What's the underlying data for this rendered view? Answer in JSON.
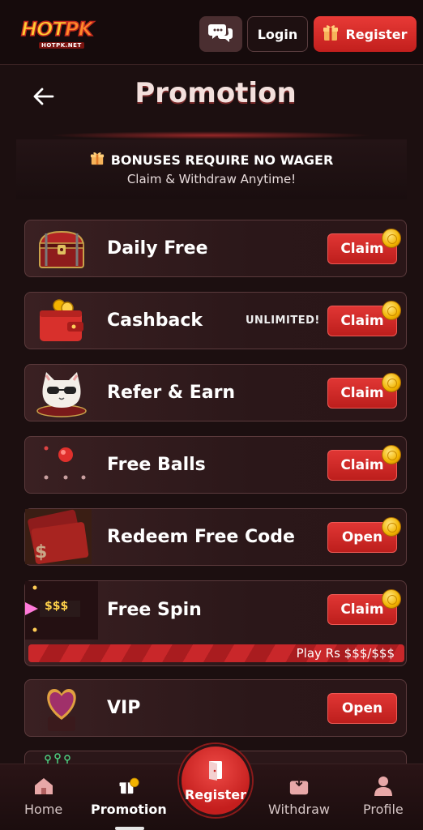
{
  "header": {
    "logo_text": "HOTPK",
    "logo_sub": "HOTPK.NET",
    "chat_icon": "chat-bubbles-icon",
    "login_label": "Login",
    "register_label": "Register"
  },
  "page": {
    "title": "Promotion"
  },
  "bonus": {
    "line1": "BONUSES REQUIRE NO WAGER",
    "line2": "Claim & Withdraw Anytime!"
  },
  "promotions": [
    {
      "label": "Daily Free",
      "extra": "",
      "button": "Claim",
      "icon": "treasure-chest-icon"
    },
    {
      "label": "Cashback",
      "extra": "UNLIMITED!",
      "button": "Claim",
      "icon": "wallet-icon"
    },
    {
      "label": "Refer & Earn",
      "extra": "",
      "button": "Claim",
      "icon": "cat-icon"
    },
    {
      "label": "Free Balls",
      "extra": "",
      "button": "Claim",
      "icon": "balls-icon"
    },
    {
      "label": "Redeem Free Code",
      "extra": "",
      "button": "Open",
      "icon": "ticket-icon"
    },
    {
      "label": "Free Spin",
      "extra": "",
      "button": "Claim",
      "icon": "spin-pointer-icon",
      "spin_badge": "$$$",
      "progress_text": "Play Rs $$$/$$$"
    },
    {
      "label": "VIP",
      "extra": "",
      "button": "Open",
      "icon": "heart-gem-icon"
    }
  ],
  "nav": {
    "home": "Home",
    "promotion": "Promotion",
    "register": "Register",
    "withdraw": "Withdraw",
    "profile": "Profile",
    "active": "promotion"
  },
  "colors": {
    "background": "#1c0f10",
    "accent_red": "#d42a28",
    "card_border": "#5b3a3c",
    "coin_gold": "#f2b300"
  }
}
